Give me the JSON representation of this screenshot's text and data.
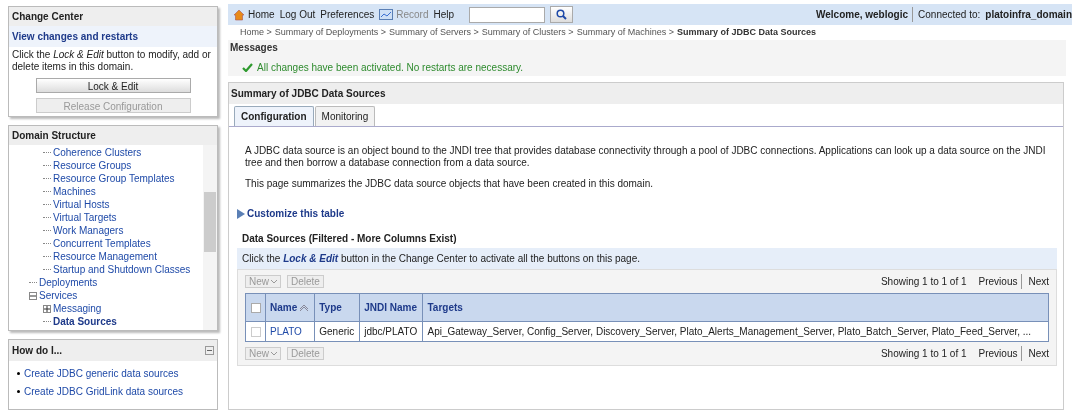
{
  "change_center": {
    "title": "Change Center",
    "link": "View changes and restarts",
    "instructions": "Click the *Lock & Edit* button to modify, add or delete items in this domain.",
    "buttons": [
      {
        "label": "Lock & Edit",
        "disabled": false
      },
      {
        "label": "Release Configuration",
        "disabled": true
      }
    ]
  },
  "domain_structure": {
    "title": "Domain Structure",
    "tree": [
      {
        "children": [
          {
            "label": "Coherence Clusters",
            "selected": false
          },
          {
            "label": "Resource Groups",
            "selected": false
          },
          {
            "label": "Resource Group Templates",
            "selected": false
          },
          {
            "label": "Machines",
            "selected": false
          },
          {
            "label": "Virtual Hosts",
            "selected": false
          },
          {
            "label": "Virtual Targets",
            "selected": false
          },
          {
            "label": "Work Managers",
            "selected": false
          },
          {
            "label": "Concurrent Templates",
            "selected": false
          },
          {
            "label": "Resource Management",
            "selected": false
          },
          {
            "label": "Startup and Shutdown Classes",
            "selected": false
          }
        ]
      },
      {
        "label": "Deployments",
        "selected": false
      },
      {
        "label": "Services",
        "selected": false,
        "expanded": true,
        "children": [
          {
            "label": "Messaging",
            "selected": false,
            "expanded": false
          },
          {
            "label": "Data Sources",
            "selected": true
          }
        ]
      }
    ]
  },
  "how_do_i": {
    "title": "How do I...",
    "links": [
      "Create JDBC generic data sources",
      "Create JDBC GridLink data sources"
    ]
  },
  "toolbar": {
    "items": [
      {
        "label": "Home",
        "kind": "home",
        "disabled": false
      },
      {
        "label": "Log Out",
        "kind": "plain",
        "disabled": false
      },
      {
        "label": "Preferences",
        "kind": "plain",
        "disabled": false
      },
      {
        "label": "Record",
        "kind": "record",
        "disabled": true
      },
      {
        "label": "Help",
        "kind": "plain",
        "disabled": false
      }
    ],
    "welcome": "Welcome, weblogic",
    "connected_label": "Connected to:",
    "domain": "platoinfra_domain"
  },
  "breadcrumbs": {
    "links": [
      "Home >",
      "Summary of Deployments >",
      "Summary of Servers >",
      "Summary of Clusters >",
      "Summary of Machines >"
    ],
    "current": "Summary of JDBC Data Sources"
  },
  "messages": {
    "title": "Messages",
    "text": "All changes have been activated. No restarts are necessary."
  },
  "summary": {
    "title": "Summary of JDBC Data Sources",
    "tabs": [
      {
        "label": "Configuration",
        "selected": true
      },
      {
        "label": "Monitoring",
        "selected": false
      }
    ],
    "paragraphs": [
      "A JDBC data source is an object bound to the JNDI tree that provides database connectivity through a pool of JDBC connections. Applications can look up a data source on the JNDI tree and then borrow a database connection from a data source.",
      "This page summarizes the JDBC data source objects that have been created in this domain."
    ],
    "customize": "Customize this table",
    "table_title": "Data Sources (Filtered - More Columns Exist)",
    "hint": "Click the **Lock & Edit** button in the Change Center to activate all the buttons on this page.",
    "pagers": [
      {
        "buttons": [
          {
            "label": "New",
            "disabled": true
          },
          {
            "label": "Delete",
            "disabled": true
          }
        ],
        "showing": "Showing 1 to 1 of 1",
        "previous": "Previous",
        "next": "Next"
      },
      {
        "buttons": [
          {
            "label": "New",
            "disabled": true
          },
          {
            "label": "Delete",
            "disabled": true
          }
        ],
        "showing": "Showing 1 to 1 of 1",
        "previous": "Previous",
        "next": "Next"
      }
    ],
    "select_all": {
      "checked": false
    },
    "columns": [
      "Name",
      "Type",
      "JNDI Name",
      "Targets"
    ],
    "rows": [
      {
        "checked": false,
        "cells": [
          "PLATO",
          "Generic",
          "jdbc/PLATO",
          "Api_Gateway_Server, Config_Server, Discovery_Server, Plato_Alerts_Management_Server, Plato_Batch_Server, Plato_Feed_Server, ..."
        ]
      }
    ]
  }
}
